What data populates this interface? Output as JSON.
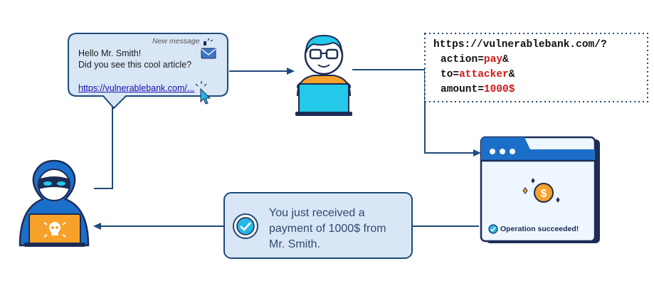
{
  "message": {
    "header": "New message",
    "greeting": "Hello Mr. Smith!",
    "body": "Did you see this cool article?",
    "link": "https://vulnerablebank.com/..."
  },
  "request": {
    "line1": "https://vulnerablebank.com/?",
    "action_key": "action=",
    "action_value": "pay",
    "amp1": "&",
    "to_key": "to=",
    "to_value": "attacker",
    "amp2": "&",
    "amount_key": "amount=",
    "amount_value": "1000$"
  },
  "notification": {
    "line1": "You just received a",
    "line2": "payment of 1000$ from",
    "line3": "Mr. Smith."
  },
  "bank_window": {
    "status": "Operation succeeded!"
  },
  "colors": {
    "arrow": "#1f4a7a",
    "bubble_fill": "#d8e6f6",
    "accent_cyan": "#24c8e8",
    "accent_orange": "#f6a12a",
    "dark_blue": "#1c2c55",
    "payload_red": "#d01818"
  },
  "icons": [
    "envelope-icon",
    "cursor-icon",
    "checkmark-icon",
    "dollar-coin-icon",
    "sparkle-icon",
    "skull-icon"
  ]
}
